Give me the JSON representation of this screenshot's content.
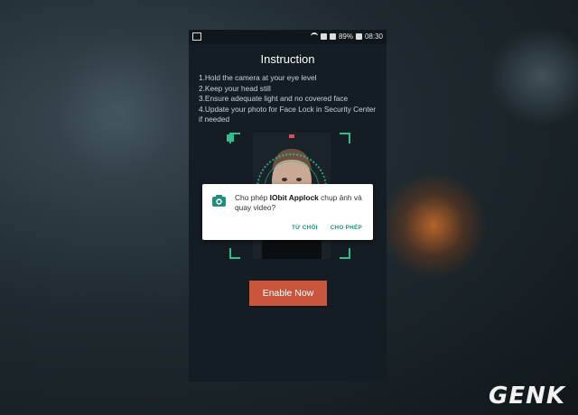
{
  "status_bar": {
    "battery": "89%",
    "time": "08:30"
  },
  "screen": {
    "title": "Instruction",
    "instructions": [
      "1.Hold the camera at your eye level",
      "2.Keep your head still",
      "3.Ensure adequate light and no covered face",
      "4.Update your photo for Face Lock in Security Center if needed"
    ],
    "enable_button": "Enable Now"
  },
  "dialog": {
    "message_prefix": "Cho phép ",
    "app_name": "IObit Applock",
    "message_suffix": " chụp ảnh và quay video?",
    "deny_label": "TỪ CHỐI",
    "allow_label": "CHO PHÉP",
    "accent_color": "#1e8f7e"
  },
  "watermark": "GENK",
  "colors": {
    "scan_green": "#2fbf8f",
    "button": "#c9553c"
  }
}
